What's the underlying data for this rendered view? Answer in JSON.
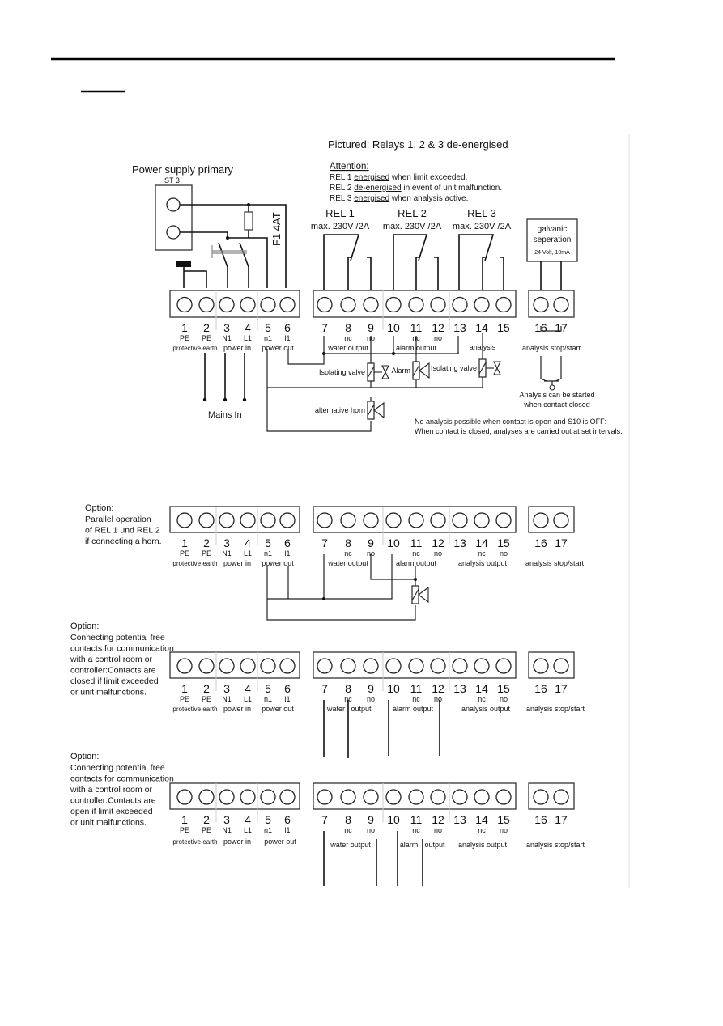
{
  "page": {
    "header_rule": true,
    "section_underline": true
  },
  "main_diagram": {
    "pictured": "Pictured:  Relays 1, 2 & 3 de-energised",
    "power_supply_title": "Power supply primary",
    "st3_label": "ST 3",
    "fuse_label": "F1  4AT",
    "attention": {
      "heading": "Attention:",
      "lines": [
        {
          "prefix": "REL 1 ",
          "emph": "energised",
          "suffix": " when limit exceeded."
        },
        {
          "prefix": "REL 2 ",
          "emph": "de-energised",
          "suffix": " in event of unit malfunction."
        },
        {
          "prefix": "REL 3  ",
          "emph": "energised",
          "suffix": " when analysis active."
        }
      ]
    },
    "relays": [
      {
        "name": "REL 1",
        "rating": "max. 230V /2A"
      },
      {
        "name": "REL 2",
        "rating": "max. 230V /2A"
      },
      {
        "name": "REL 3",
        "rating": "max. 230V /2A"
      }
    ],
    "galvanic": {
      "line1": "galvanic",
      "line2": "seperation",
      "line3": "24 Volt, 10mA"
    },
    "terminals_left": [
      "1",
      "2",
      "3",
      "4",
      "5",
      "6"
    ],
    "terminals_mid": [
      "7",
      "8",
      "9",
      "10",
      "11",
      "12",
      "13",
      "14",
      "15"
    ],
    "terminals_right": [
      "16",
      "17"
    ],
    "sub_left": [
      "PE",
      "PE",
      "N1",
      "L1",
      "n1",
      "l1"
    ],
    "sub_mid": [
      "",
      "nc",
      "no",
      "",
      "nc",
      "no",
      "",
      "",
      ""
    ],
    "group_labels": {
      "protective_earth": "protective earth",
      "power_in": "power in",
      "power_out": "power out",
      "water_output": "water output",
      "alarm_output": "alarm output",
      "analysis": "analysis",
      "analysis_stop_start": "analysis stop/start"
    },
    "mains_in": "Mains In",
    "components": {
      "isolating_valve_1": "Isolating valve",
      "alarm": "Alarm",
      "isolating_valve_2": "Isolating valve",
      "alternative_horn": "alternative horn"
    },
    "contact_note": [
      "Analysis can be started",
      "when contact closed"
    ],
    "bottom_note": [
      "No analysis possible when contact is open and S10 is OFF:",
      "When contact is closed, analyses are carried out at set intervals."
    ]
  },
  "options": [
    {
      "heading": "Option:",
      "lines": [
        "Parallel operation",
        "of REL 1 und REL 2",
        "if connecting a horn."
      ],
      "sub_mid": [
        "",
        "nc",
        "no",
        "",
        "nc",
        "no",
        "",
        "nc",
        "no"
      ],
      "group_labels": [
        "protective earth",
        "power in",
        "power out",
        "water output",
        "alarm output",
        "analysis output",
        "analysis stop/start"
      ]
    },
    {
      "heading": "Option:",
      "lines": [
        "Connecting potential free",
        "contacts for communication",
        "with a control room or",
        "controller:Contacts are",
        "closed if limit exceeded",
        "or unit malfunctions."
      ],
      "sub_mid": [
        "",
        "nc",
        "no",
        "",
        "nc",
        "no",
        "",
        "nc",
        "no"
      ],
      "group_labels": [
        "protective earth",
        "power in",
        "power out",
        "water",
        "output",
        "alarm output",
        "analysis output",
        "analysis stop/start"
      ]
    },
    {
      "heading": "Option:",
      "lines": [
        "Connecting potential free",
        "contacts for communication",
        "with a control room or",
        "controller:Contacts are",
        "open if limit exceeded",
        "or unit malfunctions."
      ],
      "sub_mid": [
        "",
        "nc",
        "no",
        "",
        "nc",
        "no",
        "",
        "nc",
        "no"
      ],
      "group_labels": [
        "protective earth",
        "power in",
        "power out",
        "water output",
        "alarm",
        "output",
        "analysis output",
        "analysis stop/start"
      ]
    }
  ]
}
